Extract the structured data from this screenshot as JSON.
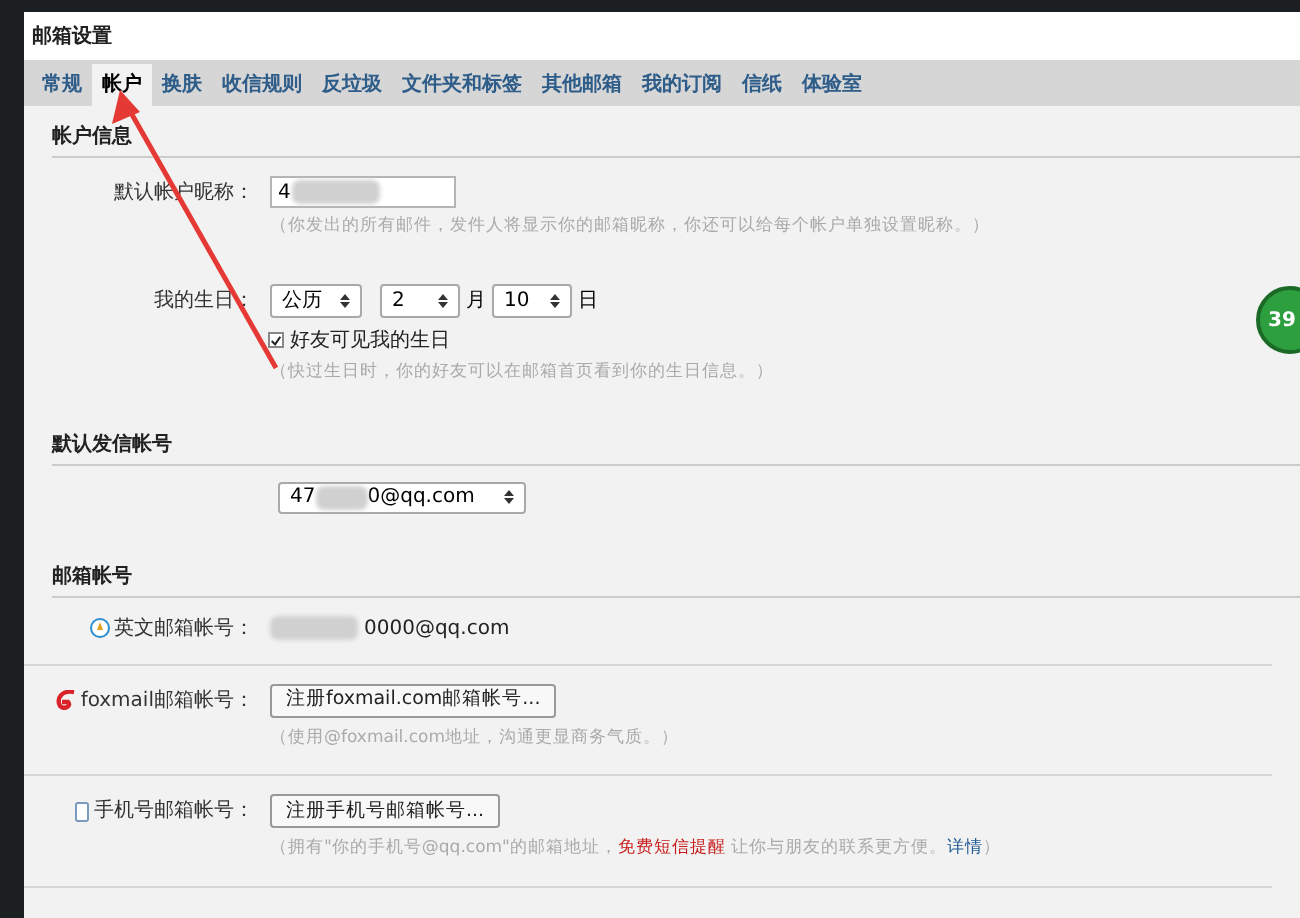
{
  "dialog_title": "邮箱设置",
  "tabs": [
    {
      "label": "常规",
      "selected": false
    },
    {
      "label": "帐户",
      "selected": true
    },
    {
      "label": "换肤",
      "selected": false
    },
    {
      "label": "收信规则",
      "selected": false
    },
    {
      "label": "反垃圾",
      "selected": false
    },
    {
      "label": "文件夹和标签",
      "selected": false
    },
    {
      "label": "其他邮箱",
      "selected": false
    },
    {
      "label": "我的订阅",
      "selected": false
    },
    {
      "label": "信纸",
      "selected": false
    },
    {
      "label": "体验室",
      "selected": false
    }
  ],
  "account_info": {
    "title": "帐户信息",
    "nickname_label": "默认帐户昵称：",
    "nickname_value": "4",
    "nickname_hint": "（你发出的所有邮件，发件人将显示你的邮箱昵称，你还可以给每个帐户单独设置昵称。）",
    "birthday_label": "我的生日：",
    "calendar": "公历",
    "month": "2",
    "month_unit": "月",
    "day": "10",
    "day_unit": "日",
    "friends_visible": {
      "label": "好友可见我的生日",
      "checked": true
    },
    "birthday_hint": "（快过生日时，你的好友可以在邮箱首页看到你的生日信息。）"
  },
  "default_sender": {
    "title": "默认发信帐号",
    "account_start": "47",
    "account_end": "0@qq.com"
  },
  "mail_accounts": {
    "title": "邮箱帐号",
    "rows": [
      {
        "kind": "text",
        "label": "英文邮箱帐号：",
        "value": "0000@qq.com"
      },
      {
        "kind": "button",
        "label": "foxmail邮箱帐号：",
        "button": "注册foxmail.com邮箱帐号...",
        "hint": "（使用@foxmail.com地址，沟通更显商务气质。）"
      },
      {
        "kind": "button",
        "label": "手机号邮箱帐号：",
        "button": "注册手机号邮箱帐号...",
        "hint_start": "（拥有\"你的手机号@qq.com\"的邮箱地址，",
        "hint_red": "免费短信提醒",
        "hint_end": " 让你与朋友的联系更方便。",
        "link": "详情",
        "hint_close": "）"
      }
    ]
  },
  "progress_badge": "39"
}
